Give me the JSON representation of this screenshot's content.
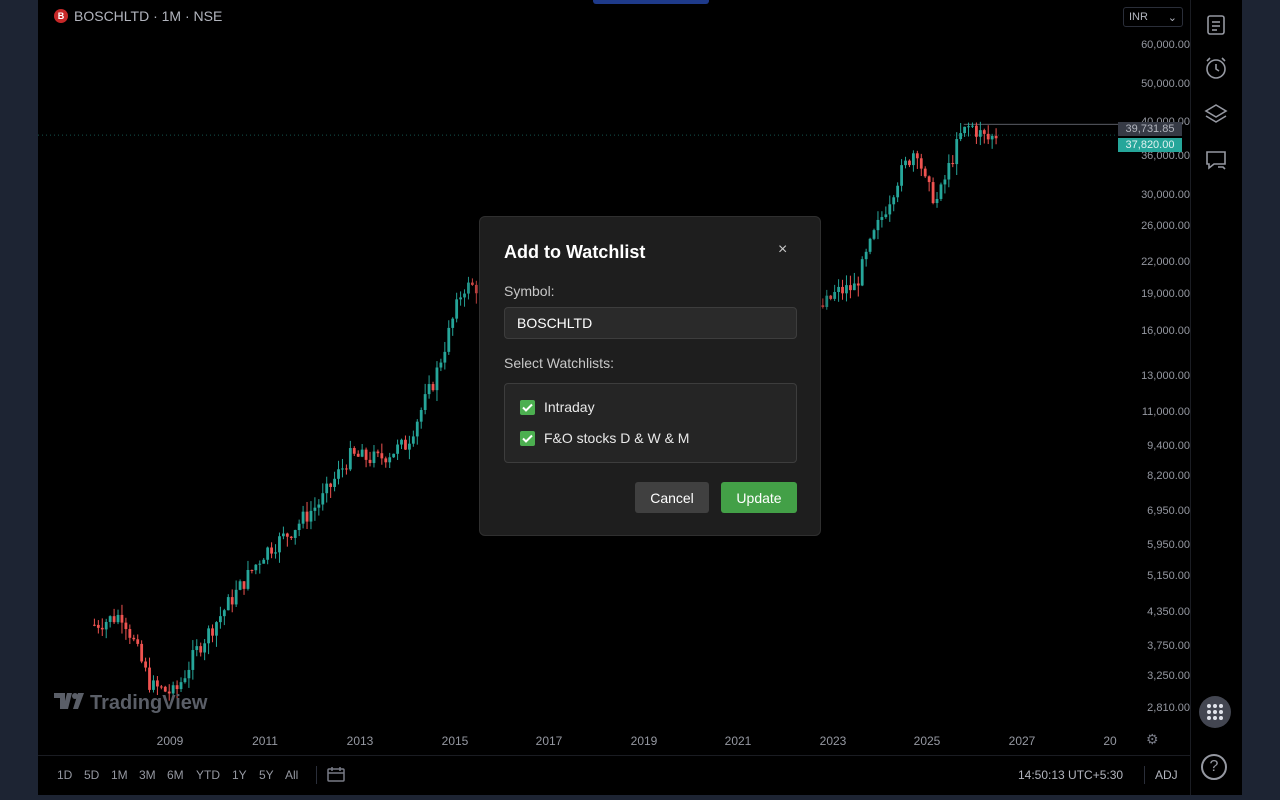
{
  "header": {
    "symbol_icon": "B",
    "symbol_title": "BOSCHLTD · 1M · NSE"
  },
  "currency": {
    "value": "INR",
    "icon": "chevron-down-icon"
  },
  "price_axis": {
    "labels": [
      "60,000.00",
      "50,000.00",
      "40,000.00",
      "36,000.00",
      "30,000.00",
      "26,000.00",
      "22,000.00",
      "19,000.00",
      "16,000.00",
      "13,000.00",
      "11,000.00",
      "9,400.00",
      "8,200.00",
      "6,950.00",
      "5,950.00",
      "5,150.00",
      "4,350.00",
      "3,750.00",
      "3,250.00",
      "2,810.00"
    ],
    "high_tag": "39,731.85",
    "last_tag": "37,820.00"
  },
  "time_axis": {
    "labels": [
      "2009",
      "2011",
      "2013",
      "2015",
      "2017",
      "2019",
      "2021",
      "2023",
      "2025",
      "2027",
      "20"
    ]
  },
  "logo_text": "TradingView",
  "bottom_bar": {
    "ranges": [
      "1D",
      "5D",
      "1M",
      "3M",
      "6M",
      "YTD",
      "1Y",
      "5Y",
      "All"
    ],
    "clock": "14:50:13 UTC+5:30",
    "adj": "ADJ"
  },
  "right_toolbar": {
    "icons": [
      "watchlist-icon",
      "alert-clock-icon",
      "layers-icon",
      "chat-icon",
      "apps-grid-icon",
      "help-icon"
    ]
  },
  "modal": {
    "title": "Add to Watchlist",
    "close": "×",
    "symbol_label": "Symbol:",
    "symbol_value": "BOSCHLTD",
    "watchlists_label": "Select Watchlists:",
    "watchlists": [
      {
        "name": "Intraday",
        "checked": true
      },
      {
        "name": "F&O stocks D & W & M",
        "checked": true
      }
    ],
    "cancel": "Cancel",
    "update": "Update"
  },
  "colors": {
    "up": "#26a69a",
    "down": "#ef5350",
    "accent_button": "#43a047",
    "checkbox": "#4caf50"
  },
  "chart_data": {
    "type": "candlestick",
    "symbol": "BOSCHLTD",
    "interval": "1M",
    "exchange": "NSE",
    "scale": "log",
    "ylim": [
      2600,
      66000
    ],
    "xlim": [
      2008.0,
      2028.2
    ],
    "last_price": 37820.0,
    "period_high": 39731.85,
    "anchors": [
      [
        2007.4,
        4100
      ],
      [
        2008.0,
        4300
      ],
      [
        2008.6,
        3100
      ],
      [
        2009.1,
        3000
      ],
      [
        2009.6,
        3700
      ],
      [
        2010.3,
        4600
      ],
      [
        2011.0,
        5700
      ],
      [
        2011.5,
        6200
      ],
      [
        2012.2,
        7200
      ],
      [
        2012.8,
        8800
      ],
      [
        2013.4,
        8700
      ],
      [
        2014.0,
        9300
      ],
      [
        2014.6,
        12500
      ],
      [
        2015.2,
        19000
      ],
      [
        2015.8,
        19000
      ],
      [
        2016.5,
        21000
      ],
      [
        2017.2,
        21500
      ],
      [
        2017.9,
        19500
      ],
      [
        2018.6,
        17500
      ],
      [
        2019.3,
        15500
      ],
      [
        2020.0,
        13500
      ],
      [
        2020.5,
        12000
      ],
      [
        2021.3,
        14500
      ],
      [
        2022.0,
        15500
      ],
      [
        2022.6,
        16500
      ],
      [
        2023.1,
        18500
      ],
      [
        2023.5,
        19000
      ],
      [
        2023.9,
        24000
      ],
      [
        2024.4,
        31000
      ],
      [
        2024.8,
        36000
      ],
      [
        2025.0,
        30000
      ],
      [
        2025.25,
        28000
      ],
      [
        2025.5,
        33000
      ],
      [
        2025.75,
        38000
      ],
      [
        2025.95,
        39500
      ],
      [
        2026.3,
        37000
      ],
      [
        2026.5,
        38000
      ]
    ]
  }
}
